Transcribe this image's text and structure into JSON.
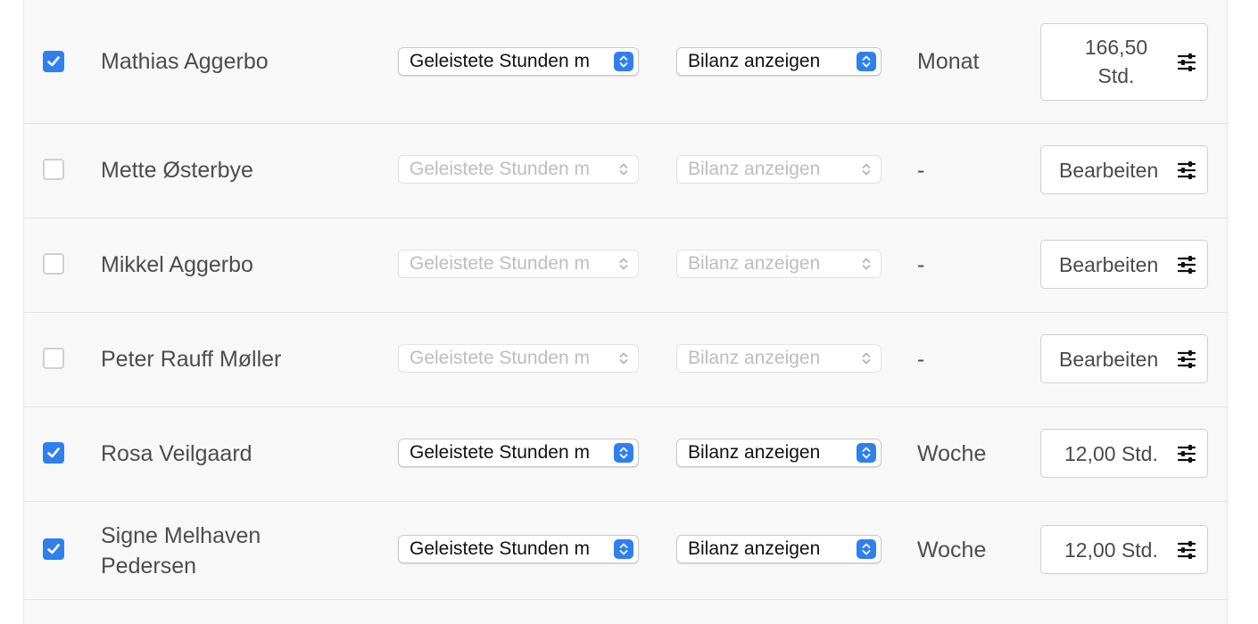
{
  "colors": {
    "accent": "#2f80ed",
    "panel_bg": "#f8f8f8",
    "row_divider": "#e3e3e3",
    "disabled_text": "#bdbdbd"
  },
  "rows": [
    {
      "checked": true,
      "name": "Mathias Aggerbo",
      "hours_select": "Geleistete Stunden m",
      "balance_select": "Bilanz anzeigen",
      "period": "Monat",
      "button_label_line1": "166,50",
      "button_label_line2": "Std.",
      "button_icon": "sliders-icon"
    },
    {
      "checked": false,
      "name": "Mette Østerbye",
      "hours_select": "Geleistete Stunden m",
      "balance_select": "Bilanz anzeigen",
      "period": "-",
      "button_label": "Bearbeiten",
      "button_icon": "sliders-icon"
    },
    {
      "checked": false,
      "name": "Mikkel Aggerbo",
      "hours_select": "Geleistete Stunden m",
      "balance_select": "Bilanz anzeigen",
      "period": "-",
      "button_label": "Bearbeiten",
      "button_icon": "sliders-icon"
    },
    {
      "checked": false,
      "name": "Peter Rauff Møller",
      "hours_select": "Geleistete Stunden m",
      "balance_select": "Bilanz anzeigen",
      "period": "-",
      "button_label": "Bearbeiten",
      "button_icon": "sliders-icon"
    },
    {
      "checked": true,
      "name": "Rosa Veilgaard",
      "hours_select": "Geleistete Stunden m",
      "balance_select": "Bilanz anzeigen",
      "period": "Woche",
      "button_label": "12,00 Std.",
      "button_icon": "sliders-icon"
    },
    {
      "checked": true,
      "name_line1": "Signe Melhaven",
      "name_line2": "Pedersen",
      "hours_select": "Geleistete Stunden m",
      "balance_select": "Bilanz anzeigen",
      "period": "Woche",
      "button_label": "12,00 Std.",
      "button_icon": "sliders-icon"
    }
  ]
}
